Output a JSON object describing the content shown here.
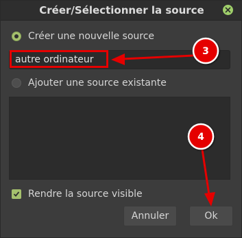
{
  "dialog": {
    "title": "Créer/Sélectionner la source"
  },
  "options": {
    "create_new_label": "Créer une nouvelle source",
    "add_existing_label": "Ajouter une source existante",
    "visible_label": "Rendre la source visible"
  },
  "name_input": {
    "value": "autre ordinateur"
  },
  "buttons": {
    "cancel_label": "Annuler",
    "ok_label": "Ok"
  },
  "annotations": {
    "step_3": "3",
    "step_4": "4"
  },
  "colors": {
    "accent": "#a5c06d",
    "annotation_red": "#e50000"
  }
}
